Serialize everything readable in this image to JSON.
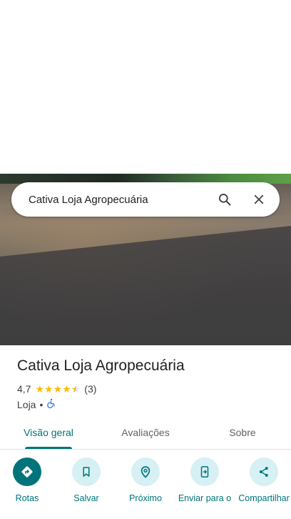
{
  "search": {
    "query": "Cativa Loja Agropecuária",
    "search_icon": "search-icon",
    "close_icon": "close-icon"
  },
  "place": {
    "name": "Cativa Loja Agropecuária",
    "rating": "4,7",
    "rating_value": 4.7,
    "review_count": "(3)",
    "category": "Loja",
    "separator": "•",
    "accessibility_icon": "wheelchair-icon"
  },
  "tabs": [
    {
      "label": "Visão geral",
      "active": true
    },
    {
      "label": "Avaliações",
      "active": false
    },
    {
      "label": "Sobre",
      "active": false
    }
  ],
  "actions": [
    {
      "label": "Rotas",
      "icon": "directions-icon"
    },
    {
      "label": "Salvar",
      "icon": "bookmark-icon"
    },
    {
      "label": "Próximo",
      "icon": "nearby-icon"
    },
    {
      "label": "Enviar para o",
      "icon": "send-to-phone-icon"
    },
    {
      "label": "Compartilhar",
      "icon": "share-icon"
    }
  ],
  "colors": {
    "accent": "#00747a",
    "accent_light": "#d6f0f3",
    "star": "#fbbc04"
  }
}
